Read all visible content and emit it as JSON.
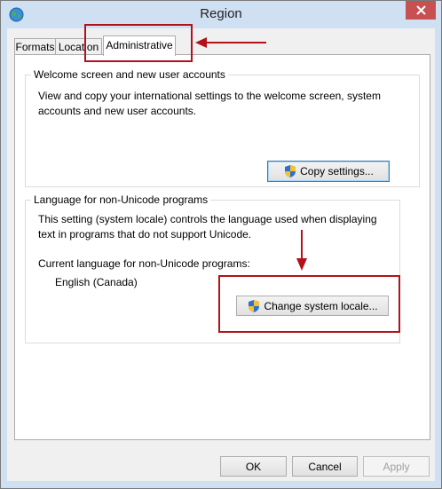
{
  "window": {
    "title": "Region"
  },
  "tabs": [
    {
      "label": "Formats"
    },
    {
      "label": "Location"
    },
    {
      "label": "Administrative"
    }
  ],
  "welcome_group": {
    "title": "Welcome screen and new user accounts",
    "description": "View and copy your international settings to the welcome screen, system accounts and new user accounts.",
    "copy_button_label": "Copy settings..."
  },
  "nonunicode_group": {
    "title": "Language for non-Unicode programs",
    "description": "This setting (system locale) controls the language used when displaying text in programs that do not support Unicode.",
    "current_label": "Current language for non-Unicode programs:",
    "current_value": "English (Canada)",
    "change_button_label": "Change system locale..."
  },
  "footer": {
    "ok_label": "OK",
    "cancel_label": "Cancel",
    "apply_label": "Apply"
  },
  "icons": {
    "app": "globe-icon",
    "close": "close-icon",
    "shield": "uac-shield-icon"
  },
  "colors": {
    "annotation": "#b3121b",
    "close_button": "#c75050",
    "title_bar": "#cfe0f3"
  }
}
